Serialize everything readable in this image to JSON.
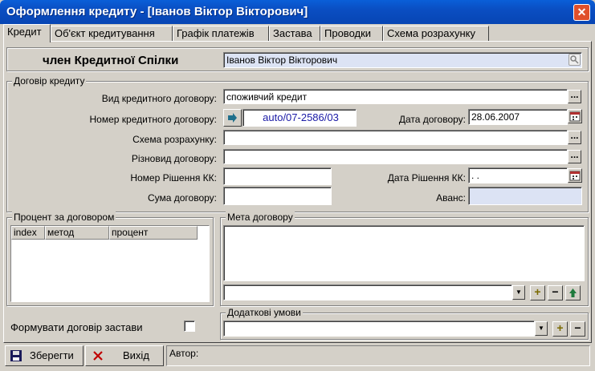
{
  "window": {
    "title": "Оформлення кредиту - [Іванов Віктор Вікторович]",
    "close": "✕"
  },
  "tabs": [
    "Кредит",
    "Об'єкт кредитування",
    "Графік платежів",
    "Застава",
    "Проводки",
    "Схема розрахунку"
  ],
  "member": {
    "label": "член Кредитної Спілки",
    "value": "Іванов Віктор Вікторович"
  },
  "contract": {
    "group_title": "Договір кредиту",
    "type_label": "Вид кредитного договору:",
    "type_value": "споживчий кредит",
    "number_label": "Номер кредитного договору:",
    "number_value": "auto/07-2586/03",
    "date_label": "Дата договору:",
    "date_value": "28.06.2007",
    "scheme_label": "Схема розрахунку:",
    "scheme_value": "",
    "kind_label": "Різновид договору:",
    "kind_value": "",
    "decision_no_label": "Номер Рішення КК:",
    "decision_no_value": "",
    "decision_date_label": "Дата Рішення КК:",
    "decision_date_value": " . .",
    "sum_label": "Сума договору:",
    "sum_value": "",
    "advance_label": "Аванс:",
    "advance_value": ""
  },
  "percent": {
    "group_title": "Процент за договором",
    "columns": [
      "index",
      "метод",
      "процент"
    ]
  },
  "purpose": {
    "group_title": "Мета договору"
  },
  "extra": {
    "group_title": "Додаткові умови"
  },
  "pledge": {
    "label": "Формувати договір застави"
  },
  "buttons": {
    "save": "Зберегти",
    "exit": "Вихід",
    "dots": "...",
    "plus": "+",
    "minus": "−"
  },
  "status": {
    "author_label": "Автор:"
  }
}
